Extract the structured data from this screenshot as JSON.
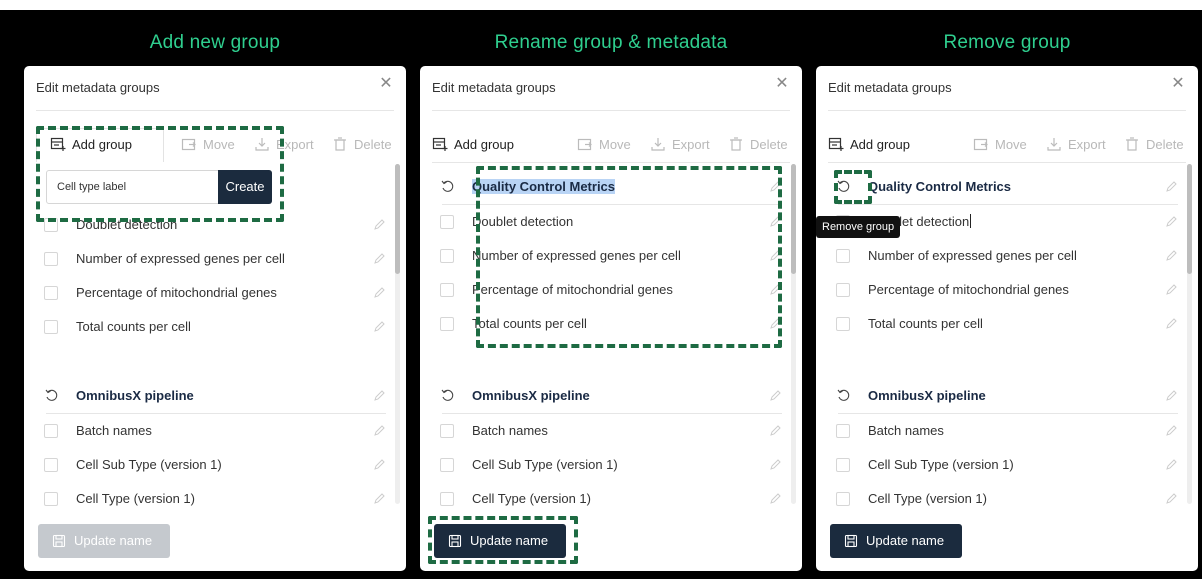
{
  "columns": [
    {
      "title": "Add new group"
    },
    {
      "title": "Rename group & metadata"
    },
    {
      "title": "Remove group"
    }
  ],
  "panel": {
    "title": "Edit metadata groups",
    "close_icon": "close-icon"
  },
  "toolbar": {
    "add_group": "Add group",
    "move": "Move",
    "export": "Export",
    "delete": "Delete"
  },
  "new_group": {
    "input_value": "Cell type label",
    "create_label": "Create"
  },
  "groups": [
    {
      "name": "Quality Control Metrics",
      "items": [
        "Doublet detection",
        "Number of expressed genes per cell",
        "Percentage of mitochondrial genes",
        "Total counts per cell"
      ]
    },
    {
      "name": "OmnibusX pipeline",
      "items": [
        "Batch names",
        "Cell Sub Type (version 1)",
        "Cell Type (version 1)"
      ]
    }
  ],
  "tooltip": "Remove group",
  "update_button": "Update name",
  "colors": {
    "accent_green": "#2fcf8f",
    "dashed_highlight": "#1e6b43",
    "button_dark": "#1b2b3e",
    "button_disabled": "#c5c9ce",
    "selection": "#b9d4f5"
  }
}
